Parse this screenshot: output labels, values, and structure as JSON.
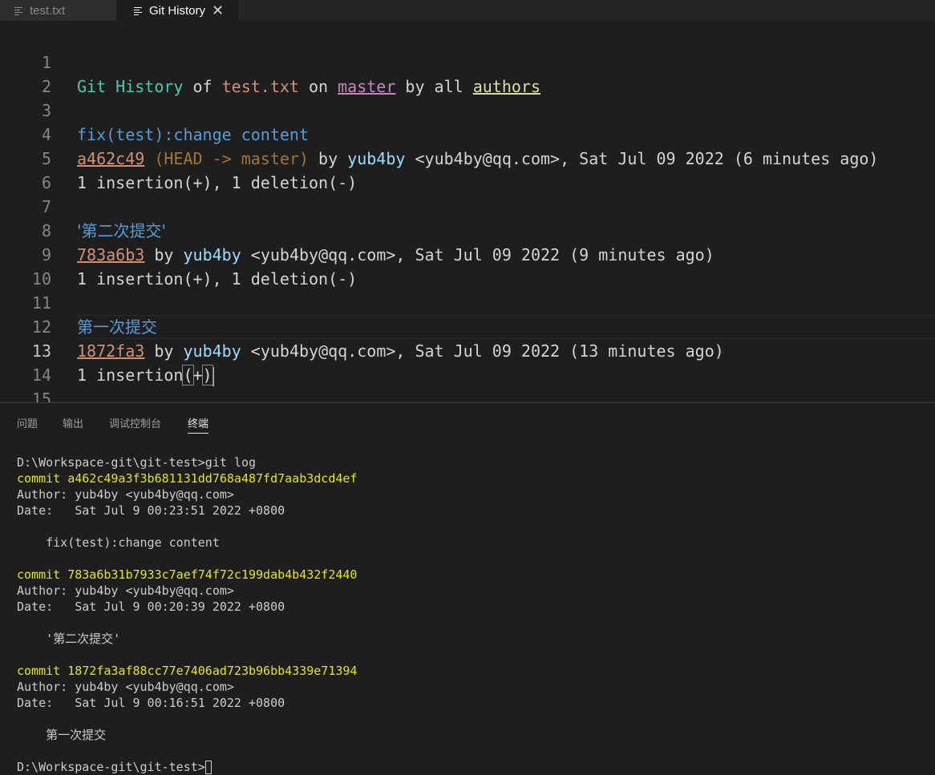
{
  "tabs": [
    {
      "label": "test.txt",
      "icon": "file-lines-icon",
      "active": false
    },
    {
      "label": "Git History",
      "icon": "file-lines-icon",
      "active": true,
      "close": "✕"
    }
  ],
  "editor": {
    "header": {
      "t1": "Git History",
      "t2": " of ",
      "t3": "test.txt",
      "t4": " on ",
      "t5": "master",
      "t6": " by all ",
      "t7": "authors"
    },
    "commits": [
      {
        "message": "fix(test):change content",
        "hash": "a462c49",
        "refs": "(HEAD -> master)",
        "by": "by",
        "author": "yub4by",
        "email": "<yub4by@qq.com>, Sat Jul 09 2022 (6 minutes ago)",
        "stats": "1 insertion(+), 1 deletion(-)"
      },
      {
        "message": "'第二次提交'",
        "hash": "783a6b3",
        "by": "by",
        "author": "yub4by",
        "email": "<yub4by@qq.com>, Sat Jul 09 2022 (9 minutes ago)",
        "stats": "1 insertion(+), 1 deletion(-)"
      },
      {
        "message": "第一次提交",
        "hash": "1872fa3",
        "by": "by",
        "author": "yub4by",
        "email": "<yub4by@qq.com>, Sat Jul 09 2022 (13 minutes ago)",
        "stats_pre": "1 insertion",
        "stats_l": "(",
        "stats_mid": "+",
        "stats_r": ")"
      }
    ],
    "line_numbers": [
      "1",
      "2",
      "3",
      "4",
      "5",
      "6",
      "7",
      "8",
      "9",
      "10",
      "11",
      "12",
      "13",
      "14",
      "15"
    ],
    "current_line": "13"
  },
  "panel": {
    "tabs": [
      "问题",
      "输出",
      "调试控制台",
      "终端"
    ],
    "active_tab": "终端",
    "terminal": {
      "prompt1": "D:\\Workspace-git\\git-test>git log",
      "entries": [
        {
          "commit": "commit a462c49a3f3b681131dd768a487fd7aab3dcd4ef",
          "author": "Author: yub4by <yub4by@qq.com>",
          "date": "Date:   Sat Jul 9 00:23:51 2022 +0800",
          "message": "    fix(test):change content"
        },
        {
          "commit": "commit 783a6b31b7933c7aef74f72c199dab4b432f2440",
          "author": "Author: yub4by <yub4by@qq.com>",
          "date": "Date:   Sat Jul 9 00:20:39 2022 +0800",
          "message": "    '第二次提交'"
        },
        {
          "commit": "commit 1872fa3af88cc77e7406ad723b96bb4339e71394",
          "author": "Author: yub4by <yub4by@qq.com>",
          "date": "Date:   Sat Jul 9 00:16:51 2022 +0800",
          "message": "    第一次提交"
        }
      ],
      "prompt2": "D:\\Workspace-git\\git-test>"
    }
  },
  "colors": {
    "background": "#1e1e1e",
    "commit_yellow": "#e5e510",
    "hash_orange": "#ce9178",
    "author_blue": "#9cdcfe",
    "message_blue": "#569cd6"
  }
}
